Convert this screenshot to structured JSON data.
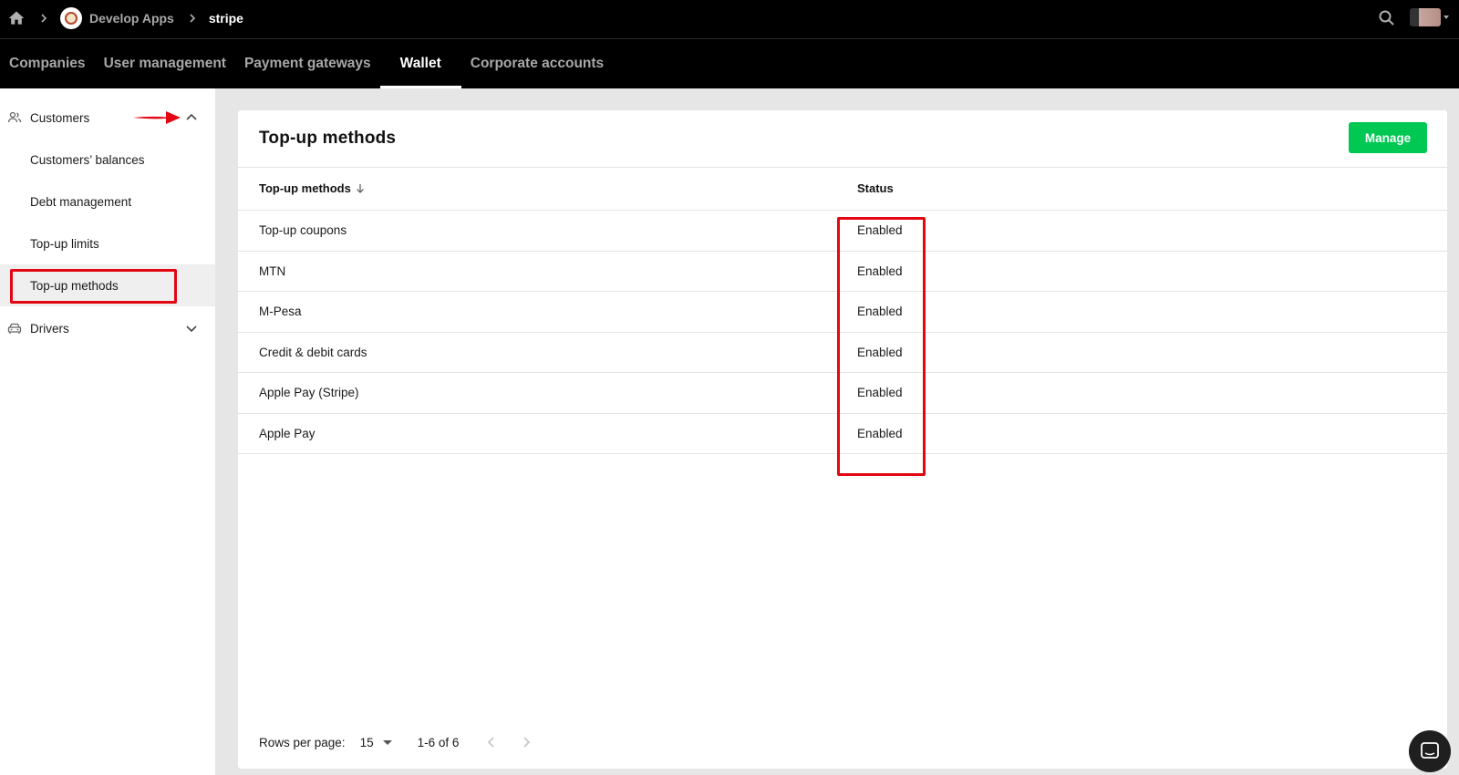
{
  "breadcrumb": {
    "app_name": "Develop Apps",
    "current": "stripe"
  },
  "tabs": [
    {
      "label": "Companies",
      "active": false
    },
    {
      "label": "User management",
      "active": false
    },
    {
      "label": "Payment gateways",
      "active": false
    },
    {
      "label": "Wallet",
      "active": true
    },
    {
      "label": "Corporate accounts",
      "active": false
    }
  ],
  "sidebar": {
    "customers": {
      "label": "Customers",
      "icon": "people-icon",
      "expanded": true
    },
    "sub_items": [
      {
        "label": "Customers’ balances",
        "active": false
      },
      {
        "label": "Debt management",
        "active": false
      },
      {
        "label": "Top-up limits",
        "active": false
      },
      {
        "label": "Top-up methods",
        "active": true
      }
    ],
    "drivers": {
      "label": "Drivers",
      "icon": "car-icon",
      "expanded": false
    }
  },
  "card": {
    "title": "Top-up methods",
    "manage_label": "Manage",
    "columns": {
      "method": "Top-up methods",
      "status": "Status"
    },
    "rows": [
      {
        "name": "Top-up coupons",
        "status": "Enabled"
      },
      {
        "name": "MTN",
        "status": "Enabled"
      },
      {
        "name": "M-Pesa",
        "status": "Enabled"
      },
      {
        "name": "Credit & debit cards",
        "status": "Enabled"
      },
      {
        "name": "Apple Pay (Stripe)",
        "status": "Enabled"
      },
      {
        "name": "Apple Pay",
        "status": "Enabled"
      }
    ],
    "footer": {
      "rows_per_page_label": "Rows per page:",
      "rows_per_page_value": "15",
      "range": "1-6 of 6"
    }
  },
  "colors": {
    "accent_green": "#00c853",
    "annotation_red": "#e30613",
    "topbar_bg": "#000000"
  }
}
